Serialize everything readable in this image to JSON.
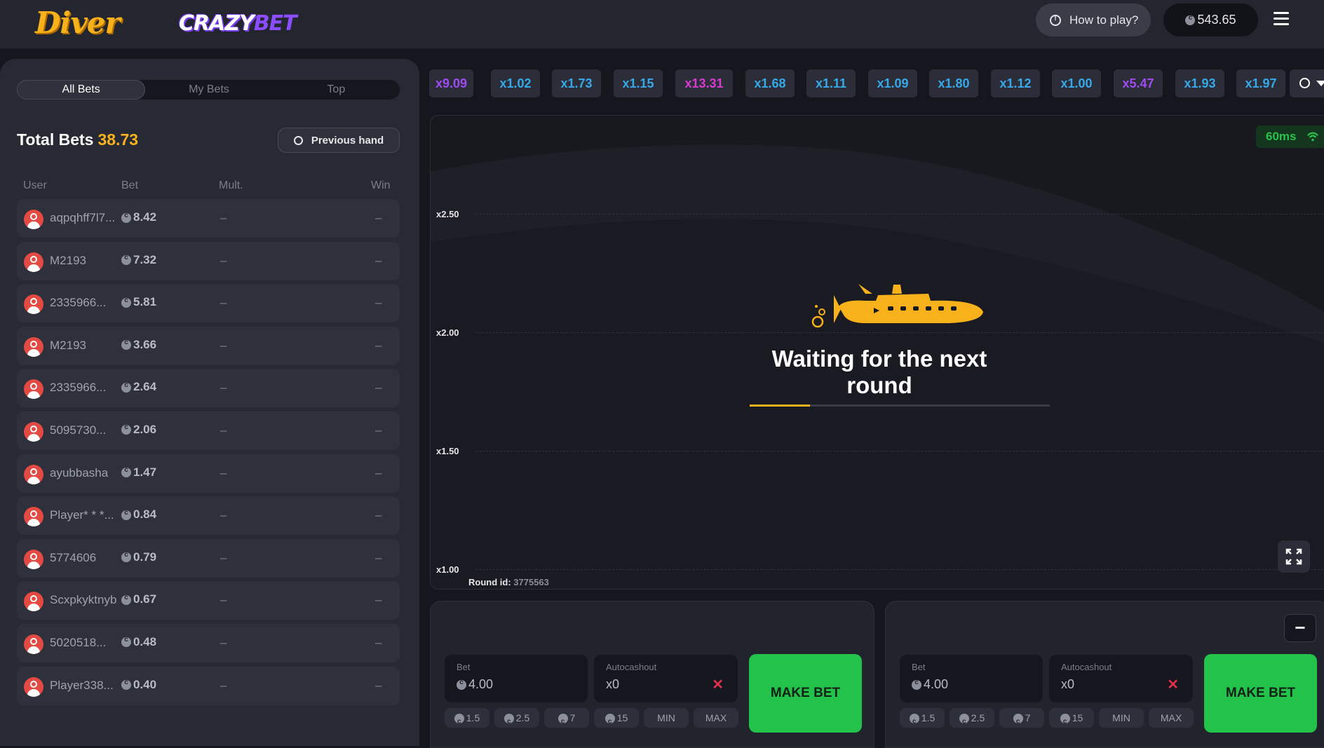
{
  "header": {
    "logo_diver": "Diver",
    "logo_crazy_part1": "CRAZY",
    "logo_crazy_part2": "BET",
    "how_to_play": "How to play?",
    "balance": "543.65"
  },
  "left": {
    "tabs": [
      "All Bets",
      "My Bets",
      "Top"
    ],
    "total_label": "Total Bets",
    "total_value": "38.73",
    "previous_hand": "Previous hand",
    "columns": [
      "User",
      "Bet",
      "Mult.",
      "Win"
    ],
    "rows": [
      {
        "user": "aqpqhff7l7...",
        "bet": "8.42",
        "mult": "–",
        "win": "–"
      },
      {
        "user": "M2193",
        "bet": "7.32",
        "mult": "–",
        "win": "–"
      },
      {
        "user": "2335966...",
        "bet": "5.81",
        "mult": "–",
        "win": "–"
      },
      {
        "user": "M2193",
        "bet": "3.66",
        "mult": "–",
        "win": "–"
      },
      {
        "user": "2335966...",
        "bet": "2.64",
        "mult": "–",
        "win": "–"
      },
      {
        "user": "5095730...",
        "bet": "2.06",
        "mult": "–",
        "win": "–"
      },
      {
        "user": "ayubbasha",
        "bet": "1.47",
        "mult": "–",
        "win": "–"
      },
      {
        "user": "Player* * *...",
        "bet": "0.84",
        "mult": "–",
        "win": "–"
      },
      {
        "user": "5774606",
        "bet": "0.79",
        "mult": "–",
        "win": "–"
      },
      {
        "user": "Scxpkyktnyb",
        "bet": "0.67",
        "mult": "–",
        "win": "–"
      },
      {
        "user": "5020518...",
        "bet": "0.48",
        "mult": "–",
        "win": "–"
      },
      {
        "user": "Player338...",
        "bet": "0.40",
        "mult": "–",
        "win": "–"
      }
    ]
  },
  "history": [
    {
      "label": "x9.09",
      "color": "purple"
    },
    {
      "label": "x1.02",
      "color": "blue"
    },
    {
      "label": "x1.73",
      "color": "blue"
    },
    {
      "label": "x1.15",
      "color": "blue"
    },
    {
      "label": "x13.31",
      "color": "pink"
    },
    {
      "label": "x1.68",
      "color": "blue"
    },
    {
      "label": "x1.11",
      "color": "blue"
    },
    {
      "label": "x1.09",
      "color": "blue"
    },
    {
      "label": "x1.80",
      "color": "blue"
    },
    {
      "label": "x1.12",
      "color": "blue"
    },
    {
      "label": "x1.00",
      "color": "blue"
    },
    {
      "label": "x5.47",
      "color": "purple"
    },
    {
      "label": "x1.93",
      "color": "blue"
    },
    {
      "label": "x1.97",
      "color": "blue"
    }
  ],
  "game": {
    "ping": "60ms",
    "y_labels": [
      "x2.50",
      "x2.00",
      "x1.50",
      "x1.00"
    ],
    "waiting_text": "Waiting for the next round",
    "progress": 0.2,
    "round_label": "Round id:",
    "round_id": "3775563"
  },
  "bet_panels": [
    {
      "bet_label": "Bet",
      "bet_value": "4.00",
      "auto_label": "Autocashout",
      "auto_value": "x0",
      "button": "MAKE BET",
      "quick": [
        "1.5",
        "2.5",
        "7",
        "15",
        "MIN",
        "MAX"
      ]
    },
    {
      "bet_label": "Bet",
      "bet_value": "4.00",
      "auto_label": "Autocashout",
      "auto_value": "x0",
      "button": "MAKE BET",
      "quick": [
        "1.5",
        "2.5",
        "7",
        "15",
        "MIN",
        "MAX"
      ],
      "minus": "−"
    }
  ],
  "colors": {
    "accent": "#f7b21b",
    "green": "#23c24a",
    "blue": "#37a8e8",
    "purple": "#a04bf2",
    "pink": "#d63ad1"
  }
}
